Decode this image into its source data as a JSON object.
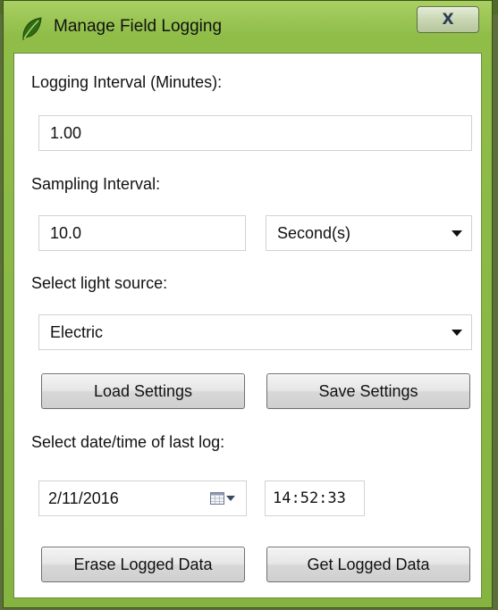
{
  "window": {
    "title": "Manage Field Logging",
    "close_label": "X"
  },
  "logging": {
    "label": "Logging Interval (Minutes):",
    "value": "1.00"
  },
  "sampling": {
    "label": "Sampling Interval:",
    "value": "10.0",
    "unit_selected": "Second(s)"
  },
  "light_source": {
    "label": "Select light source:",
    "selected": "Electric"
  },
  "buttons": {
    "load": "Load Settings",
    "save": "Save Settings",
    "erase": "Erase Logged Data",
    "get": "Get Logged Data"
  },
  "last_log": {
    "label": "Select date/time of last log:",
    "date": "2/11/2016",
    "time": "14:52:33"
  },
  "icons": {
    "app": "leaf-icon",
    "calendar": "calendar-icon"
  },
  "colors": {
    "frame": "#8fbd48",
    "button_face": "#e6e6e6"
  }
}
